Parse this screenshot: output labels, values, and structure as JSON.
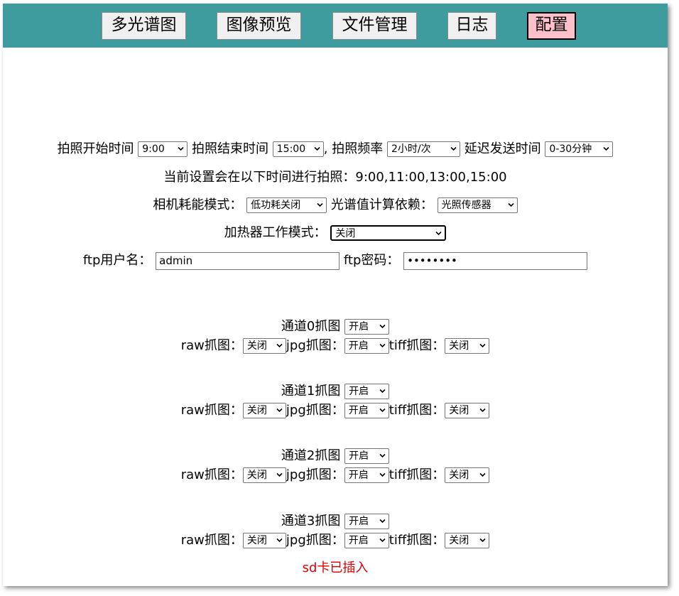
{
  "nav": {
    "items": [
      {
        "label": "多光谱图"
      },
      {
        "label": "图像预览"
      },
      {
        "label": "文件管理"
      },
      {
        "label": "日志"
      },
      {
        "label": "配置"
      }
    ]
  },
  "schedule": {
    "start_label": "拍照开始时间",
    "start_value": "9:00",
    "end_label": "拍照结束时间",
    "end_value": "15:00",
    "freq_label": ", 拍照频率",
    "freq_value": "2小时/次",
    "delay_label": "延迟发送时间",
    "delay_value": "0-30分钟",
    "summary": "当前设置会在以下时间进行拍照：9:00,11:00,13:00,15:00"
  },
  "camera": {
    "power_label": "相机耗能模式：",
    "power_value": "低功耗关闭",
    "spectral_label": "光谱值计算依赖：",
    "spectral_value": "光照传感器"
  },
  "heater": {
    "label": "加热器工作模式：",
    "value": "关闭"
  },
  "ftp": {
    "user_label": "ftp用户名：",
    "user_value": "admin",
    "pass_label": "ftp密码：",
    "pass_value": "••••••••"
  },
  "channels": [
    {
      "title": "通道0抓图",
      "capture": "开启",
      "raw_label": "raw抓图：",
      "raw": "关闭",
      "jpg_label": "jpg抓图：",
      "jpg": "开启",
      "tiff_label": "tiff抓图：",
      "tiff": "关闭"
    },
    {
      "title": "通道1抓图",
      "capture": "开启",
      "raw_label": "raw抓图：",
      "raw": "关闭",
      "jpg_label": "jpg抓图：",
      "jpg": "开启",
      "tiff_label": "tiff抓图：",
      "tiff": "关闭"
    },
    {
      "title": "通道2抓图",
      "capture": "开启",
      "raw_label": "raw抓图：",
      "raw": "关闭",
      "jpg_label": "jpg抓图：",
      "jpg": "开启",
      "tiff_label": "tiff抓图：",
      "tiff": "关闭"
    },
    {
      "title": "通道3抓图",
      "capture": "开启",
      "raw_label": "raw抓图：",
      "raw": "关闭",
      "jpg_label": "jpg抓图：",
      "jpg": "开启",
      "tiff_label": "tiff抓图：",
      "tiff": "关闭"
    }
  ],
  "status": {
    "sd": "sd卡已插入"
  },
  "colors": {
    "topbar": "#3f9c9e",
    "active_tab": "#ffc0cb",
    "status_text": "#e00000"
  },
  "icons": {
    "dropdown": "chevron-down-icon"
  }
}
